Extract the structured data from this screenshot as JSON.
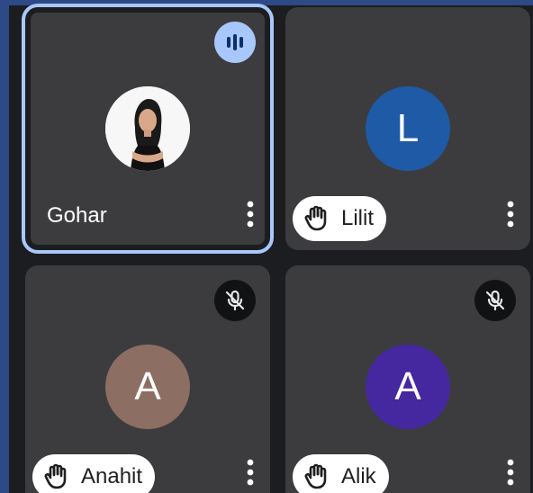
{
  "colors": {
    "background": "#1c1d20",
    "tile": "#3c3c3f",
    "active_outline": "#a8c7fa",
    "edge": "#2d4a86"
  },
  "participants": [
    {
      "name": "Gohar",
      "avatar_type": "photo",
      "avatar_icon": "profile-photo",
      "status_icon": "speaking-indicator-icon",
      "hand_raised": false,
      "active_speaker": true
    },
    {
      "name": "Lilit",
      "avatar_type": "initial",
      "initial": "L",
      "avatar_color": "#1f5aa6",
      "hand_raised": true,
      "hand_icon": "raised-hand-icon"
    },
    {
      "name": "Anahit",
      "avatar_type": "initial",
      "initial": "A",
      "avatar_color": "#8d6e63",
      "hand_raised": true,
      "hand_icon": "raised-hand-icon",
      "status_icon": "mic-off-icon",
      "muted": true
    },
    {
      "name": "Alik",
      "avatar_type": "initial",
      "initial": "A",
      "avatar_color": "#4527a0",
      "hand_raised": true,
      "hand_icon": "raised-hand-icon",
      "status_icon": "mic-off-icon",
      "muted": true
    }
  ],
  "more_options_icon": "more-vert-icon"
}
